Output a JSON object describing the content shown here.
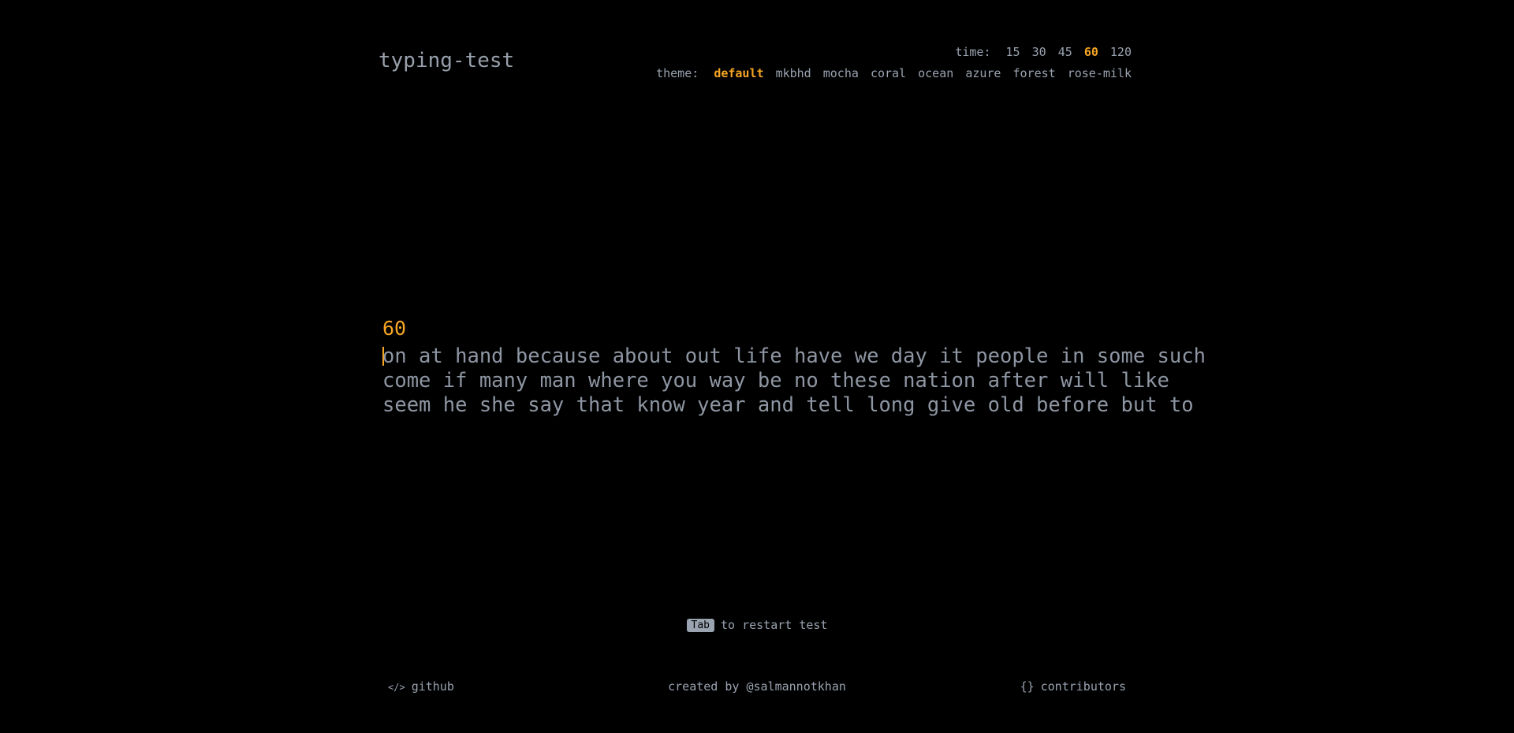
{
  "header": {
    "logo": "typing-test"
  },
  "settings": {
    "time_label": "time:",
    "time_options": [
      "15",
      "30",
      "45",
      "60",
      "120"
    ],
    "time_active": "60",
    "theme_label": "theme:",
    "theme_options": [
      "default",
      "mkbhd",
      "mocha",
      "coral",
      "ocean",
      "azure",
      "forest",
      "rose-milk"
    ],
    "theme_active": "default"
  },
  "test": {
    "timer": "60",
    "lines": [
      "on at hand because about out life have we day it people in some such",
      "come if many man where you way be no these nation after will like",
      "seem he she say that know year and tell long give old before but to"
    ]
  },
  "hint": {
    "key": "Tab",
    "text": "to restart test"
  },
  "footer": {
    "github_icon": "</>",
    "github": "github",
    "credit": "created by @salmannotkhan",
    "contributors_icon": "{}",
    "contributors": "contributors"
  },
  "colors": {
    "background": "#000000",
    "text": "#9aa3b0",
    "accent": "#f6a623"
  }
}
